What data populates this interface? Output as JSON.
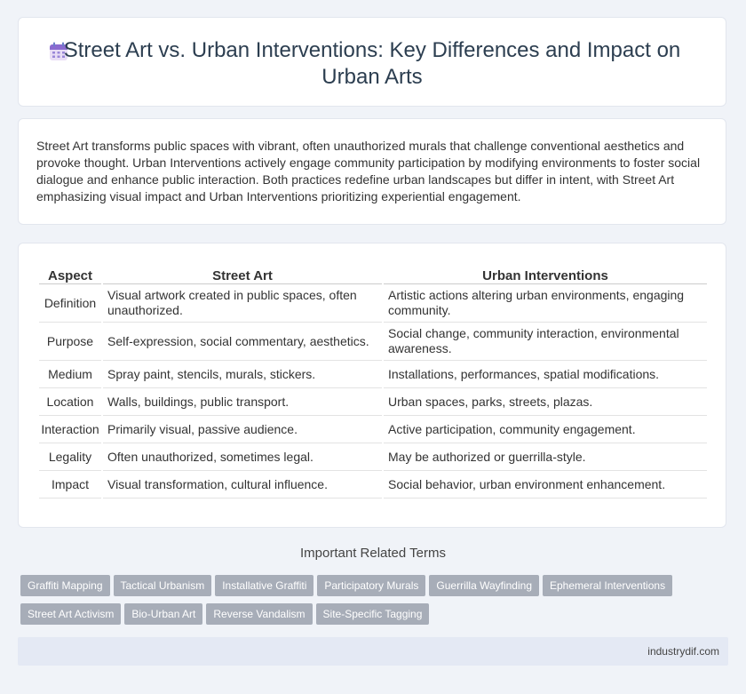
{
  "header": {
    "title": "Street Art vs. Urban Interventions: Key Differences and Impact on Urban Arts",
    "icon": "calendar-icon"
  },
  "intro": {
    "text": "Street Art transforms public spaces with vibrant, often unauthorized murals that challenge conventional aesthetics and provoke thought. Urban Interventions actively engage community participation by modifying environments to foster social dialogue and enhance public interaction. Both practices redefine urban landscapes but differ in intent, with Street Art emphasizing visual impact and Urban Interventions prioritizing experiential engagement."
  },
  "table": {
    "headers": [
      "Aspect",
      "Street Art",
      "Urban Interventions"
    ],
    "rows": [
      [
        "Definition",
        "Visual artwork created in public spaces, often unauthorized.",
        "Artistic actions altering urban environments, engaging community."
      ],
      [
        "Purpose",
        "Self-expression, social commentary, aesthetics.",
        "Social change, community interaction, environmental awareness."
      ],
      [
        "Medium",
        "Spray paint, stencils, murals, stickers.",
        "Installations, performances, spatial modifications."
      ],
      [
        "Location",
        "Walls, buildings, public transport.",
        "Urban spaces, parks, streets, plazas."
      ],
      [
        "Interaction",
        "Primarily visual, passive audience.",
        "Active participation, community engagement."
      ],
      [
        "Legality",
        "Often unauthorized, sometimes legal.",
        "May be authorized or guerrilla-style."
      ],
      [
        "Impact",
        "Visual transformation, cultural influence.",
        "Social behavior, urban environment enhancement."
      ]
    ]
  },
  "related": {
    "title": "Important Related Terms",
    "tags": [
      "Graffiti Mapping",
      "Tactical Urbanism",
      "Installative Graffiti",
      "Participatory Murals",
      "Guerrilla Wayfinding",
      "Ephemeral Interventions",
      "Street Art Activism",
      "Bio-Urban Art",
      "Reverse Vandalism",
      "Site-Specific Tagging"
    ]
  },
  "footer": {
    "site": "industrydif.com"
  }
}
